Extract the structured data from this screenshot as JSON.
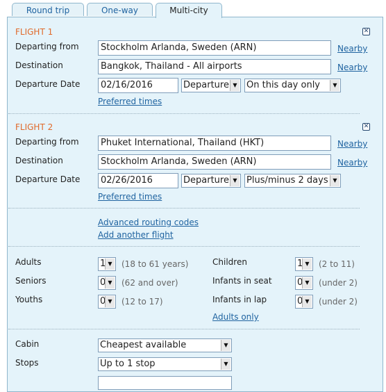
{
  "tabs": [
    {
      "label": "Round trip",
      "active": false
    },
    {
      "label": "One-way",
      "active": false
    },
    {
      "label": "Multi-city",
      "active": true
    }
  ],
  "flights": [
    {
      "title": "FLIGHT 1",
      "departing_label": "Departing from",
      "departing_value": "Stockholm Arlanda, Sweden (ARN)",
      "destination_label": "Destination",
      "destination_value": "Bangkok, Thailand - All airports",
      "date_label": "Departure Date",
      "date_value": "02/16/2016",
      "time_type": "Departure",
      "flexibility": "On this day only",
      "nearby": "Nearby",
      "preferred_times": "Preferred times"
    },
    {
      "title": "FLIGHT 2",
      "departing_label": "Departing from",
      "departing_value": "Phuket International, Thailand (HKT)",
      "destination_label": "Destination",
      "destination_value": "Stockholm Arlanda, Sweden (ARN)",
      "date_label": "Departure Date",
      "date_value": "02/26/2016",
      "time_type": "Departure",
      "flexibility": "Plus/minus 2 days",
      "nearby": "Nearby",
      "preferred_times": "Preferred times"
    }
  ],
  "links": {
    "advanced_routing": "Advanced routing codes",
    "add_flight": "Add another flight",
    "adults_only": "Adults only"
  },
  "passengers": {
    "adults": {
      "label": "Adults",
      "value": "1",
      "hint": "(18 to 61 years)"
    },
    "seniors": {
      "label": "Seniors",
      "value": "0",
      "hint": "(62 and over)"
    },
    "youths": {
      "label": "Youths",
      "value": "0",
      "hint": "(12 to 17)"
    },
    "children": {
      "label": "Children",
      "value": "1",
      "hint": "(2 to 11)"
    },
    "infants_seat": {
      "label": "Infants in seat",
      "value": "0",
      "hint": "(under 2)"
    },
    "infants_lap": {
      "label": "Infants in lap",
      "value": "0",
      "hint": "(under 2)"
    }
  },
  "options": {
    "cabin_label": "Cabin",
    "cabin_value": "Cheapest available",
    "stops_label": "Stops",
    "stops_value": "Up to 1 stop"
  },
  "icons": {
    "close": "close-x-icon",
    "dropdown": "chevron-down-icon"
  },
  "colors": {
    "panel_bg": "#e4f3fa",
    "flight_title": "#e06a2b",
    "link": "#1f63a0",
    "border": "#8fb6cc"
  }
}
